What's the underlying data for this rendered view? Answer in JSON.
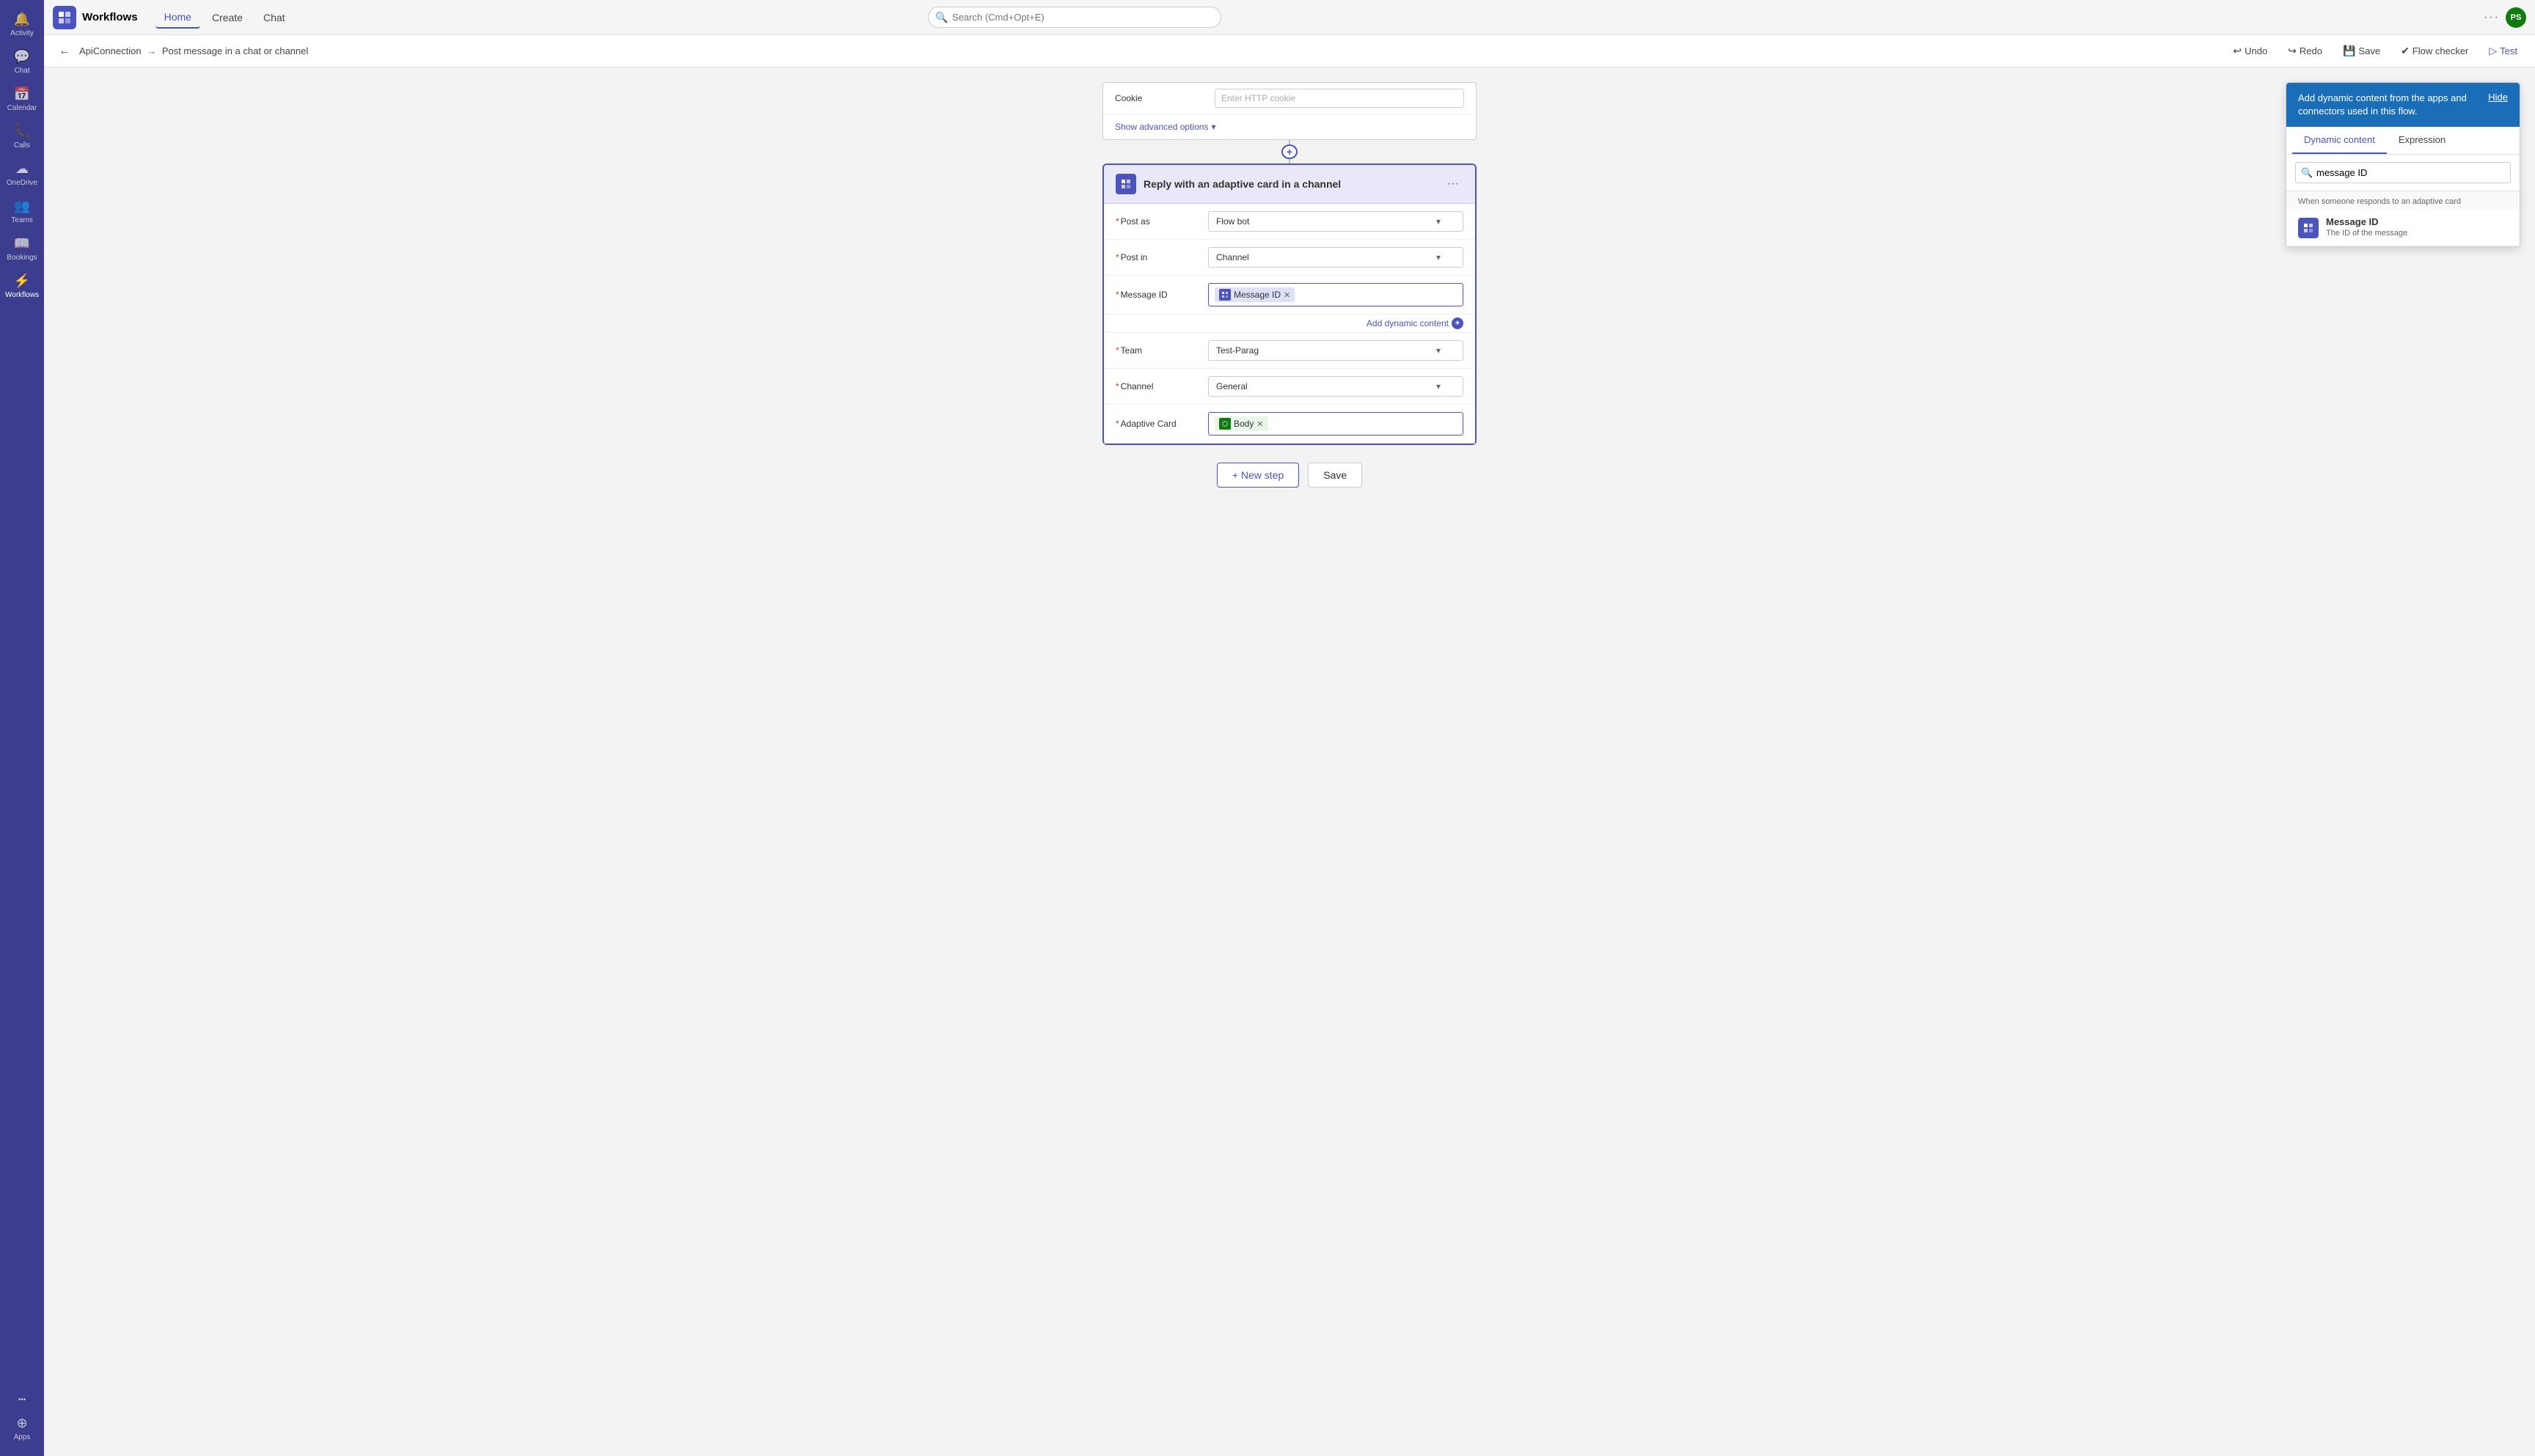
{
  "app": {
    "title": "Workflows",
    "search_placeholder": "Search (Cmd+Opt+E)"
  },
  "topbar": {
    "nav_items": [
      "Home",
      "Create",
      "Chat"
    ],
    "active_nav": "Home"
  },
  "sub_topbar": {
    "breadcrumb_parts": [
      "ApiConnection",
      "->",
      "Post message in a chat or channel"
    ],
    "actions": {
      "undo": "Undo",
      "redo": "Redo",
      "save": "Save",
      "flow_checker": "Flow checker",
      "test": "Test"
    }
  },
  "sidebar": {
    "items": [
      {
        "id": "activity",
        "label": "Activity",
        "icon": "🔔"
      },
      {
        "id": "chat",
        "label": "Chat",
        "icon": "💬"
      },
      {
        "id": "calendar",
        "label": "Calendar",
        "icon": "📅"
      },
      {
        "id": "calls",
        "label": "Calls",
        "icon": "📞"
      },
      {
        "id": "onedrive",
        "label": "OneDrive",
        "icon": "☁"
      },
      {
        "id": "teams",
        "label": "Teams",
        "icon": "👥"
      },
      {
        "id": "bookings",
        "label": "Bookings",
        "icon": "📖"
      },
      {
        "id": "workflows",
        "label": "Workflows",
        "icon": "⚡"
      },
      {
        "id": "apps",
        "label": "Apps",
        "icon": "⚙"
      }
    ],
    "active": "workflows"
  },
  "cookie_section": {
    "label": "Cookie",
    "placeholder": "Enter HTTP cookie",
    "show_advanced_label": "Show advanced options"
  },
  "reply_card": {
    "title": "Reply with an adaptive card in a channel",
    "post_as_label": "Post as",
    "post_as_value": "Flow bot",
    "post_in_label": "Post in",
    "post_in_value": "Channel",
    "message_id_label": "Message ID",
    "message_id_token": "Message ID",
    "add_dynamic_label": "Add dynamic content",
    "team_label": "Team",
    "team_value": "Test-Parag",
    "channel_label": "Channel",
    "channel_value": "General",
    "adaptive_card_label": "Adaptive Card",
    "adaptive_card_token": "Body"
  },
  "flow_actions": {
    "new_step": "+ New step",
    "save": "Save"
  },
  "dynamic_panel": {
    "header_text": "Add dynamic content from the apps and connectors used in this flow.",
    "hide_label": "Hide",
    "tabs": [
      "Dynamic content",
      "Expression"
    ],
    "active_tab": "Dynamic content",
    "search_value": "message ID",
    "section_label": "When someone responds to an adaptive card",
    "items": [
      {
        "name": "Message ID",
        "description": "The ID of the message"
      }
    ]
  }
}
